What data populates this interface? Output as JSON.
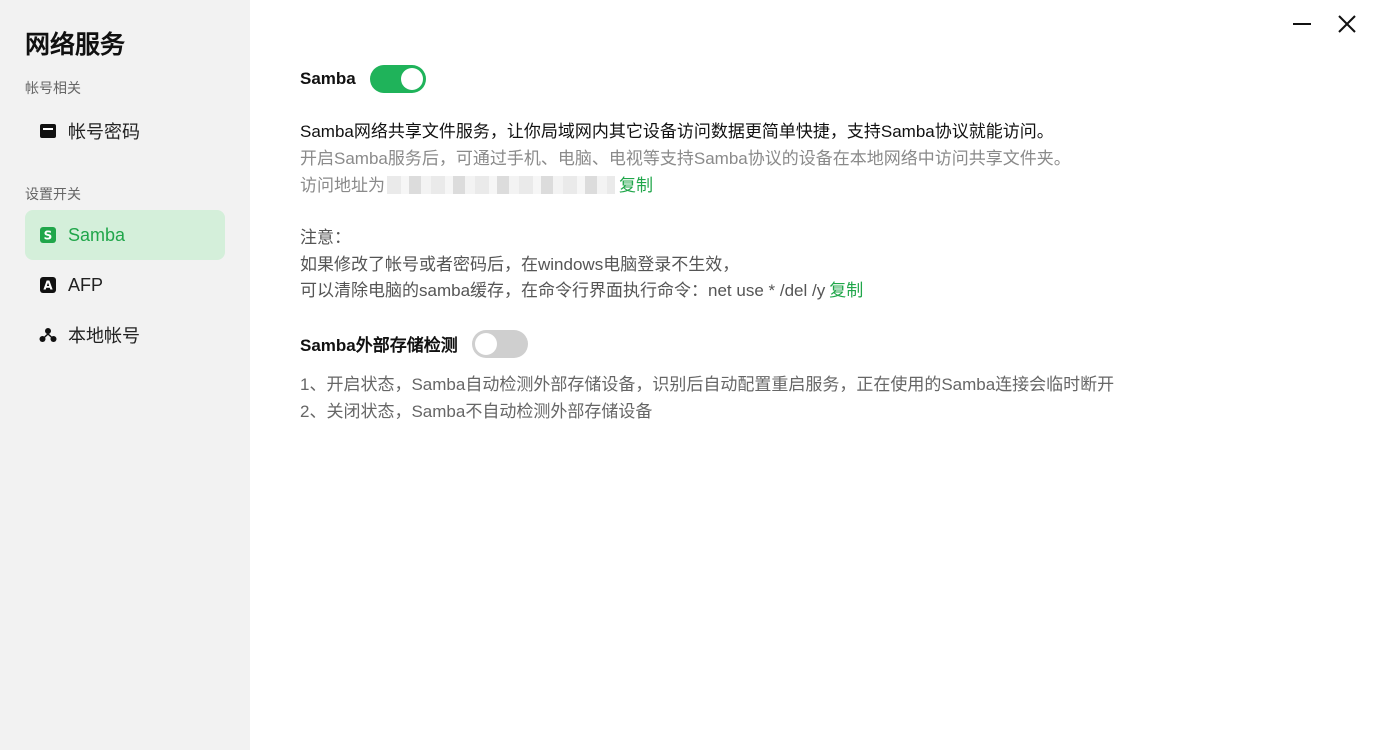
{
  "sidebar": {
    "title": "网络服务",
    "section_account": "帐号相关",
    "section_settings": "设置开关",
    "items": [
      {
        "label": "帐号密码",
        "icon": "card-icon"
      },
      {
        "label": "Samba",
        "icon": "samba-s-icon",
        "active": true
      },
      {
        "label": "AFP",
        "icon": "afp-a-icon"
      },
      {
        "label": "本地帐号",
        "icon": "users-icon"
      }
    ]
  },
  "window": {
    "minimize_icon": "minimize-icon",
    "close_icon": "close-icon"
  },
  "samba": {
    "label": "Samba",
    "enabled": true,
    "desc_main": "Samba网络共享文件服务，让你局域网内其它设备访问数据更简单快捷，支持Samba协议就能访问。",
    "desc_sub": "开启Samba服务后，可通过手机、电脑、电视等支持Samba协议的设备在本地网络中访问共享文件夹。",
    "address_prefix": "访问地址为",
    "copy_label": "复制",
    "note_title": "注意：",
    "note_line1": "如果修改了帐号或者密码后，在windows电脑登录不生效，",
    "note_line2": "可以清除电脑的samba缓存，在命令行界面执行命令：net use * /del /y",
    "note_copy_label": "复制"
  },
  "external": {
    "label": "Samba外部存储检测",
    "enabled": false,
    "line1": "1、开启状态，Samba自动检测外部存储设备，识别后自动配置重启服务，正在使用的Samba连接会临时断开",
    "line2": "2、关闭状态，Samba不自动检测外部存储设备"
  },
  "colors": {
    "accent": "#1fb35a",
    "active_bg": "#d4efda",
    "sidebar_bg": "#f2f2f2"
  }
}
